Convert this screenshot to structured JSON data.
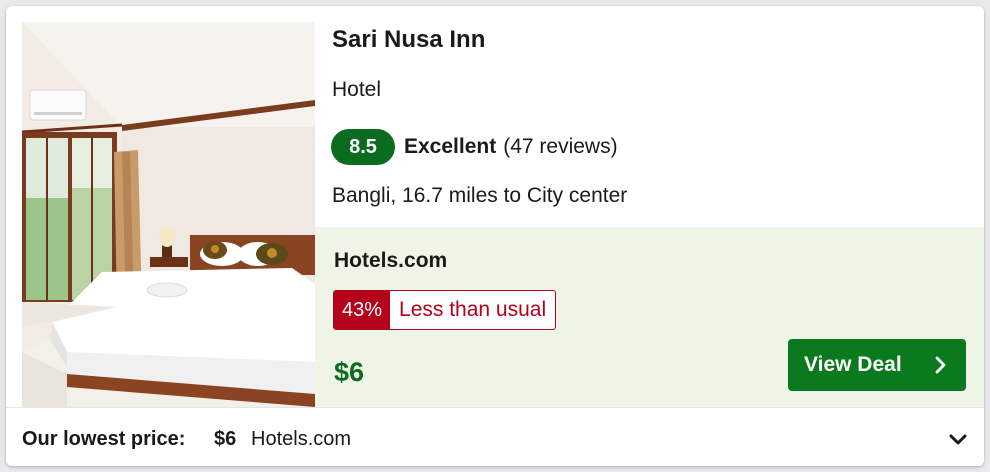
{
  "hotel": {
    "name": "Sari Nusa Inn",
    "type": "Hotel",
    "rating_score": "8.5",
    "rating_label": "Excellent",
    "reviews": "(47 reviews)",
    "location": "Bangli, 16.7 miles to City center"
  },
  "deal": {
    "provider": "Hotels.com",
    "discount_percent": "43%",
    "discount_text": "Less than usual",
    "price": "$6",
    "button_label": "View Deal"
  },
  "footer": {
    "label": "Our lowest price:",
    "price": "$6",
    "provider": "Hotels.com"
  },
  "colors": {
    "rating_badge": "#0b6b1f",
    "price_green": "#0b6b1f",
    "button_green": "#0b7a1e",
    "discount_red": "#b3001b",
    "deal_background": "#eef5e6"
  },
  "icons": {
    "button": "chevron-right-icon",
    "footer": "chevron-down-icon"
  }
}
